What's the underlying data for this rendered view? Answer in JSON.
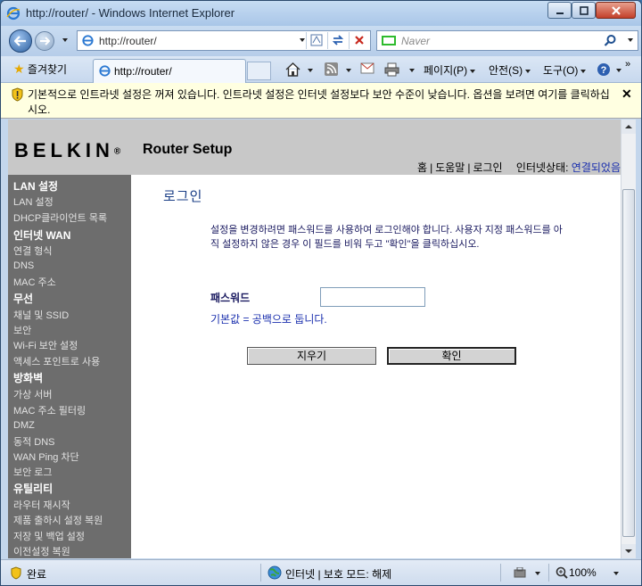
{
  "window": {
    "title": "http://router/ - Windows Internet Explorer"
  },
  "address": {
    "url": "http://router/"
  },
  "search": {
    "placeholder": "Naver"
  },
  "commandbar": {
    "favorites_label": "즐겨찾기",
    "tab_title": "http://router/",
    "page_menu": "페이지(P)",
    "safety_menu": "안전(S)",
    "tools_menu": "도구(O)"
  },
  "infobar": {
    "message": "기본적으로 인트라넷 설정은 꺼져 있습니다. 인트라넷 설정은 인터넷 설정보다 보안 수준이 낮습니다. 옵션을 보려면 여기를 클릭하십시오."
  },
  "header": {
    "brand": "BELKIN",
    "brand_mark": "®",
    "title": "Router Setup",
    "links": [
      "홈",
      "도움말",
      "로그인"
    ],
    "status_label": "인터넷상태:",
    "status_value": "연결되었음"
  },
  "sidebar": {
    "sections": [
      {
        "title": "LAN 설정",
        "items": [
          "LAN 설정",
          "DHCP클라이언트 목록"
        ]
      },
      {
        "title": "인터넷 WAN",
        "items": [
          "연결 형식",
          "DNS",
          "MAC 주소"
        ]
      },
      {
        "title": "무선",
        "items": [
          "채널 및 SSID",
          "보안",
          "Wi-Fi 보안 설정",
          "액세스 포인트로 사용"
        ]
      },
      {
        "title": "방화벽",
        "items": [
          "가상 서버",
          "MAC 주소 필터링",
          "DMZ",
          "동적 DNS",
          "WAN Ping 차단",
          "보안 로그"
        ]
      },
      {
        "title": "유틸리티",
        "items": [
          "라우터 재시작",
          "제품 출하시 설정 복원",
          "저장 및 백업 설정",
          "이전설정 복원"
        ]
      }
    ]
  },
  "login": {
    "title": "로그인",
    "description": "설정을 변경하려면 패스워드를 사용하여 로그인해야 합니다. 사용자 지정 패스워드를 아직 설정하지 않은 경우 이 필드를 비워 두고 \"확인\"을 클릭하십시오.",
    "password_label": "패스워드",
    "password_value": "",
    "hint": "기본값 = 공백으로 둡니다.",
    "clear_button": "지우기",
    "ok_button": "확인"
  },
  "statusbar": {
    "status": "완료",
    "zone": "인터넷 | 보호 모드: 해제",
    "zoom": "100%"
  }
}
